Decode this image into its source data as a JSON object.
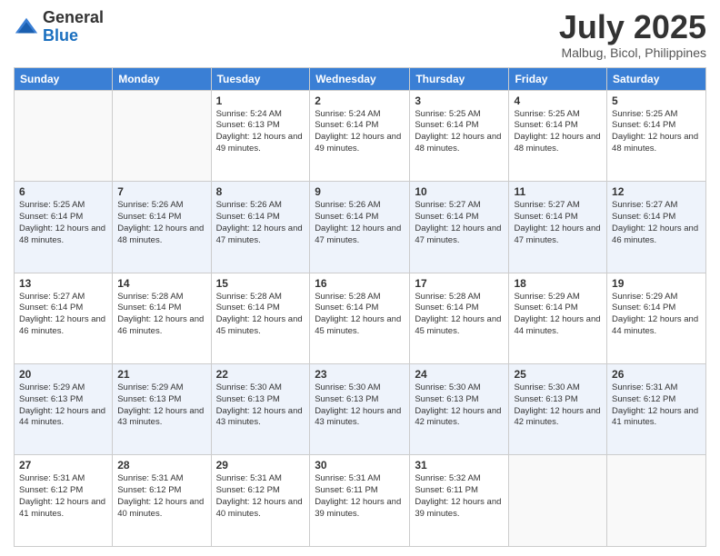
{
  "header": {
    "logo_general": "General",
    "logo_blue": "Blue",
    "month_title": "July 2025",
    "location": "Malbug, Bicol, Philippines"
  },
  "calendar": {
    "days_of_week": [
      "Sunday",
      "Monday",
      "Tuesday",
      "Wednesday",
      "Thursday",
      "Friday",
      "Saturday"
    ],
    "weeks": [
      [
        {
          "day": "",
          "sunrise": "",
          "sunset": "",
          "daylight": ""
        },
        {
          "day": "",
          "sunrise": "",
          "sunset": "",
          "daylight": ""
        },
        {
          "day": "1",
          "sunrise": "Sunrise: 5:24 AM",
          "sunset": "Sunset: 6:13 PM",
          "daylight": "Daylight: 12 hours and 49 minutes."
        },
        {
          "day": "2",
          "sunrise": "Sunrise: 5:24 AM",
          "sunset": "Sunset: 6:14 PM",
          "daylight": "Daylight: 12 hours and 49 minutes."
        },
        {
          "day": "3",
          "sunrise": "Sunrise: 5:25 AM",
          "sunset": "Sunset: 6:14 PM",
          "daylight": "Daylight: 12 hours and 48 minutes."
        },
        {
          "day": "4",
          "sunrise": "Sunrise: 5:25 AM",
          "sunset": "Sunset: 6:14 PM",
          "daylight": "Daylight: 12 hours and 48 minutes."
        },
        {
          "day": "5",
          "sunrise": "Sunrise: 5:25 AM",
          "sunset": "Sunset: 6:14 PM",
          "daylight": "Daylight: 12 hours and 48 minutes."
        }
      ],
      [
        {
          "day": "6",
          "sunrise": "Sunrise: 5:25 AM",
          "sunset": "Sunset: 6:14 PM",
          "daylight": "Daylight: 12 hours and 48 minutes."
        },
        {
          "day": "7",
          "sunrise": "Sunrise: 5:26 AM",
          "sunset": "Sunset: 6:14 PM",
          "daylight": "Daylight: 12 hours and 48 minutes."
        },
        {
          "day": "8",
          "sunrise": "Sunrise: 5:26 AM",
          "sunset": "Sunset: 6:14 PM",
          "daylight": "Daylight: 12 hours and 47 minutes."
        },
        {
          "day": "9",
          "sunrise": "Sunrise: 5:26 AM",
          "sunset": "Sunset: 6:14 PM",
          "daylight": "Daylight: 12 hours and 47 minutes."
        },
        {
          "day": "10",
          "sunrise": "Sunrise: 5:27 AM",
          "sunset": "Sunset: 6:14 PM",
          "daylight": "Daylight: 12 hours and 47 minutes."
        },
        {
          "day": "11",
          "sunrise": "Sunrise: 5:27 AM",
          "sunset": "Sunset: 6:14 PM",
          "daylight": "Daylight: 12 hours and 47 minutes."
        },
        {
          "day": "12",
          "sunrise": "Sunrise: 5:27 AM",
          "sunset": "Sunset: 6:14 PM",
          "daylight": "Daylight: 12 hours and 46 minutes."
        }
      ],
      [
        {
          "day": "13",
          "sunrise": "Sunrise: 5:27 AM",
          "sunset": "Sunset: 6:14 PM",
          "daylight": "Daylight: 12 hours and 46 minutes."
        },
        {
          "day": "14",
          "sunrise": "Sunrise: 5:28 AM",
          "sunset": "Sunset: 6:14 PM",
          "daylight": "Daylight: 12 hours and 46 minutes."
        },
        {
          "day": "15",
          "sunrise": "Sunrise: 5:28 AM",
          "sunset": "Sunset: 6:14 PM",
          "daylight": "Daylight: 12 hours and 45 minutes."
        },
        {
          "day": "16",
          "sunrise": "Sunrise: 5:28 AM",
          "sunset": "Sunset: 6:14 PM",
          "daylight": "Daylight: 12 hours and 45 minutes."
        },
        {
          "day": "17",
          "sunrise": "Sunrise: 5:28 AM",
          "sunset": "Sunset: 6:14 PM",
          "daylight": "Daylight: 12 hours and 45 minutes."
        },
        {
          "day": "18",
          "sunrise": "Sunrise: 5:29 AM",
          "sunset": "Sunset: 6:14 PM",
          "daylight": "Daylight: 12 hours and 44 minutes."
        },
        {
          "day": "19",
          "sunrise": "Sunrise: 5:29 AM",
          "sunset": "Sunset: 6:14 PM",
          "daylight": "Daylight: 12 hours and 44 minutes."
        }
      ],
      [
        {
          "day": "20",
          "sunrise": "Sunrise: 5:29 AM",
          "sunset": "Sunset: 6:13 PM",
          "daylight": "Daylight: 12 hours and 44 minutes."
        },
        {
          "day": "21",
          "sunrise": "Sunrise: 5:29 AM",
          "sunset": "Sunset: 6:13 PM",
          "daylight": "Daylight: 12 hours and 43 minutes."
        },
        {
          "day": "22",
          "sunrise": "Sunrise: 5:30 AM",
          "sunset": "Sunset: 6:13 PM",
          "daylight": "Daylight: 12 hours and 43 minutes."
        },
        {
          "day": "23",
          "sunrise": "Sunrise: 5:30 AM",
          "sunset": "Sunset: 6:13 PM",
          "daylight": "Daylight: 12 hours and 43 minutes."
        },
        {
          "day": "24",
          "sunrise": "Sunrise: 5:30 AM",
          "sunset": "Sunset: 6:13 PM",
          "daylight": "Daylight: 12 hours and 42 minutes."
        },
        {
          "day": "25",
          "sunrise": "Sunrise: 5:30 AM",
          "sunset": "Sunset: 6:13 PM",
          "daylight": "Daylight: 12 hours and 42 minutes."
        },
        {
          "day": "26",
          "sunrise": "Sunrise: 5:31 AM",
          "sunset": "Sunset: 6:12 PM",
          "daylight": "Daylight: 12 hours and 41 minutes."
        }
      ],
      [
        {
          "day": "27",
          "sunrise": "Sunrise: 5:31 AM",
          "sunset": "Sunset: 6:12 PM",
          "daylight": "Daylight: 12 hours and 41 minutes."
        },
        {
          "day": "28",
          "sunrise": "Sunrise: 5:31 AM",
          "sunset": "Sunset: 6:12 PM",
          "daylight": "Daylight: 12 hours and 40 minutes."
        },
        {
          "day": "29",
          "sunrise": "Sunrise: 5:31 AM",
          "sunset": "Sunset: 6:12 PM",
          "daylight": "Daylight: 12 hours and 40 minutes."
        },
        {
          "day": "30",
          "sunrise": "Sunrise: 5:31 AM",
          "sunset": "Sunset: 6:11 PM",
          "daylight": "Daylight: 12 hours and 39 minutes."
        },
        {
          "day": "31",
          "sunrise": "Sunrise: 5:32 AM",
          "sunset": "Sunset: 6:11 PM",
          "daylight": "Daylight: 12 hours and 39 minutes."
        },
        {
          "day": "",
          "sunrise": "",
          "sunset": "",
          "daylight": ""
        },
        {
          "day": "",
          "sunrise": "",
          "sunset": "",
          "daylight": ""
        }
      ]
    ]
  }
}
